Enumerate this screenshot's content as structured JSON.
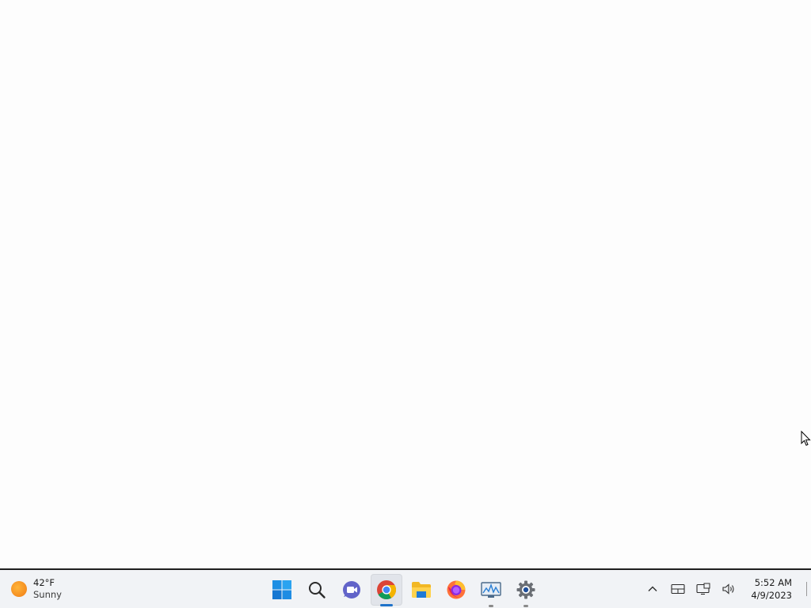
{
  "weather": {
    "temperature": "42°F",
    "condition": "Sunny",
    "icon": "sun-icon"
  },
  "taskbar": {
    "pinned": [
      {
        "name": "start-button",
        "icon": "windows-logo-icon",
        "active": false,
        "running": false
      },
      {
        "name": "search-button",
        "icon": "search-icon",
        "active": false,
        "running": false
      },
      {
        "name": "teams-chat-button",
        "icon": "video-chat-icon",
        "active": false,
        "running": false
      },
      {
        "name": "chrome-button",
        "icon": "chrome-icon",
        "active": true,
        "running": true
      },
      {
        "name": "file-explorer-button",
        "icon": "folder-icon",
        "active": false,
        "running": false
      },
      {
        "name": "firefox-button",
        "icon": "firefox-icon",
        "active": false,
        "running": false
      },
      {
        "name": "resource-monitor-button",
        "icon": "monitor-chart-icon",
        "active": false,
        "running": true
      },
      {
        "name": "settings-button",
        "icon": "gear-icon",
        "active": false,
        "running": true
      }
    ]
  },
  "tray": {
    "icons": [
      "chevron-up-icon",
      "touch-keyboard-icon",
      "network-icon",
      "volume-icon"
    ]
  },
  "clock": {
    "time": "5:52 AM",
    "date": "4/9/2023"
  },
  "colors": {
    "taskbar_bg": "#f1f3f6",
    "active_indicator": "#1f72c9",
    "desktop_bg": "#fdfdfd"
  }
}
